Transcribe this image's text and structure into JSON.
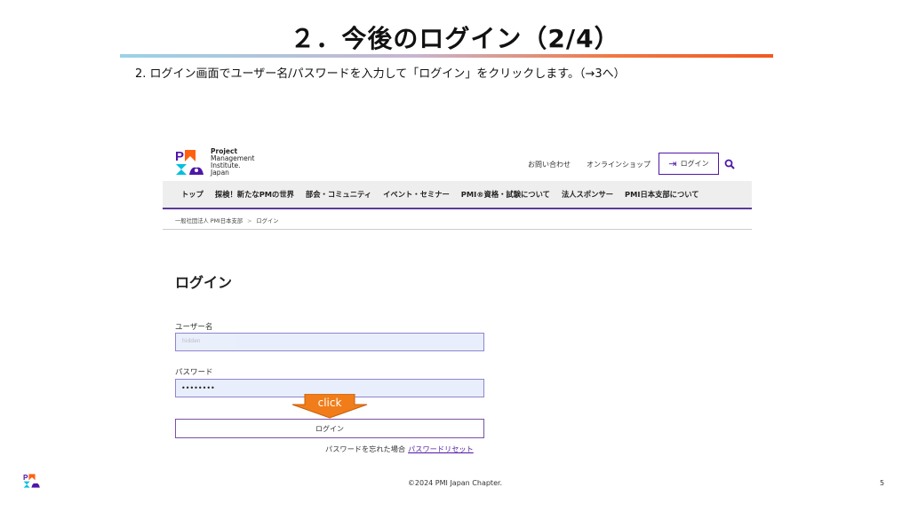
{
  "slide": {
    "title": "２．今後のログイン（2/4）",
    "instruction": "2. ログイン画面でユーザー名/パスワードを入力して「ログイン」をクリックします。（→3へ）",
    "footer": "©2024 PMI Japan Chapter.",
    "page_number": "5"
  },
  "site": {
    "logo_lines": [
      "Project",
      "Management",
      "Institute.",
      "Japan"
    ],
    "header_links": [
      "お問い合わせ",
      "オンラインショップ"
    ],
    "login_button": "ログイン",
    "nav": [
      "トップ",
      "探検！新たなPMの世界",
      "部会・コミュニティ",
      "イベント・セミナー",
      "PMI®資格・試験について",
      "法人スポンサー",
      "PMI日本支部について"
    ],
    "breadcrumb": [
      "一般社団法人 PMI日本支部",
      "ログイン"
    ],
    "colors": {
      "brand_purple": "#4f17a8",
      "brand_orange": "#ff610f",
      "brand_teal": "#05bfe0"
    }
  },
  "login_form": {
    "heading": "ログイン",
    "username_label": "ユーザー名",
    "username_value": "hidden",
    "password_label": "パスワード",
    "password_value": "••••••••",
    "submit_label": "ログイン",
    "forgot_text": "パスワードを忘れた場合",
    "reset_link": "パスワードリセット"
  },
  "callout": {
    "text": "click",
    "color": "#f07d1a"
  }
}
